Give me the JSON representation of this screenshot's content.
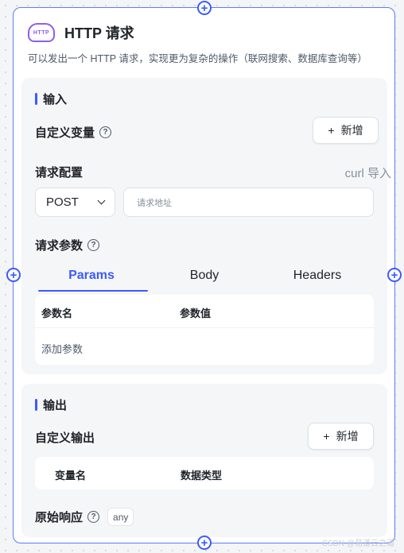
{
  "node": {
    "logo_text": "HTTP",
    "title": "HTTP 请求",
    "description": "可以发出一个 HTTP 请求，实现更为复杂的操作（联网搜索、数据库查询等）"
  },
  "input_section": {
    "title": "输入",
    "custom_vars_label": "自定义变量",
    "add_label": "新增",
    "request_config_label": "请求配置",
    "curl_import": "curl 导入",
    "method": "POST",
    "url_placeholder": "请求地址",
    "request_params_label": "请求参数",
    "tabs": [
      "Params",
      "Body",
      "Headers"
    ],
    "active_tab": "Params",
    "table_headers": [
      "参数名",
      "参数值"
    ],
    "add_param": "添加参数"
  },
  "output_section": {
    "title": "输出",
    "custom_output_label": "自定义输出",
    "add_label": "新增",
    "table_headers": [
      "变量名",
      "数据类型"
    ],
    "raw_response_label": "原始响应",
    "raw_response_type": "any"
  },
  "help_glyph": "?",
  "plus_glyph": "+",
  "watermark": "CSDN @易道云之道"
}
